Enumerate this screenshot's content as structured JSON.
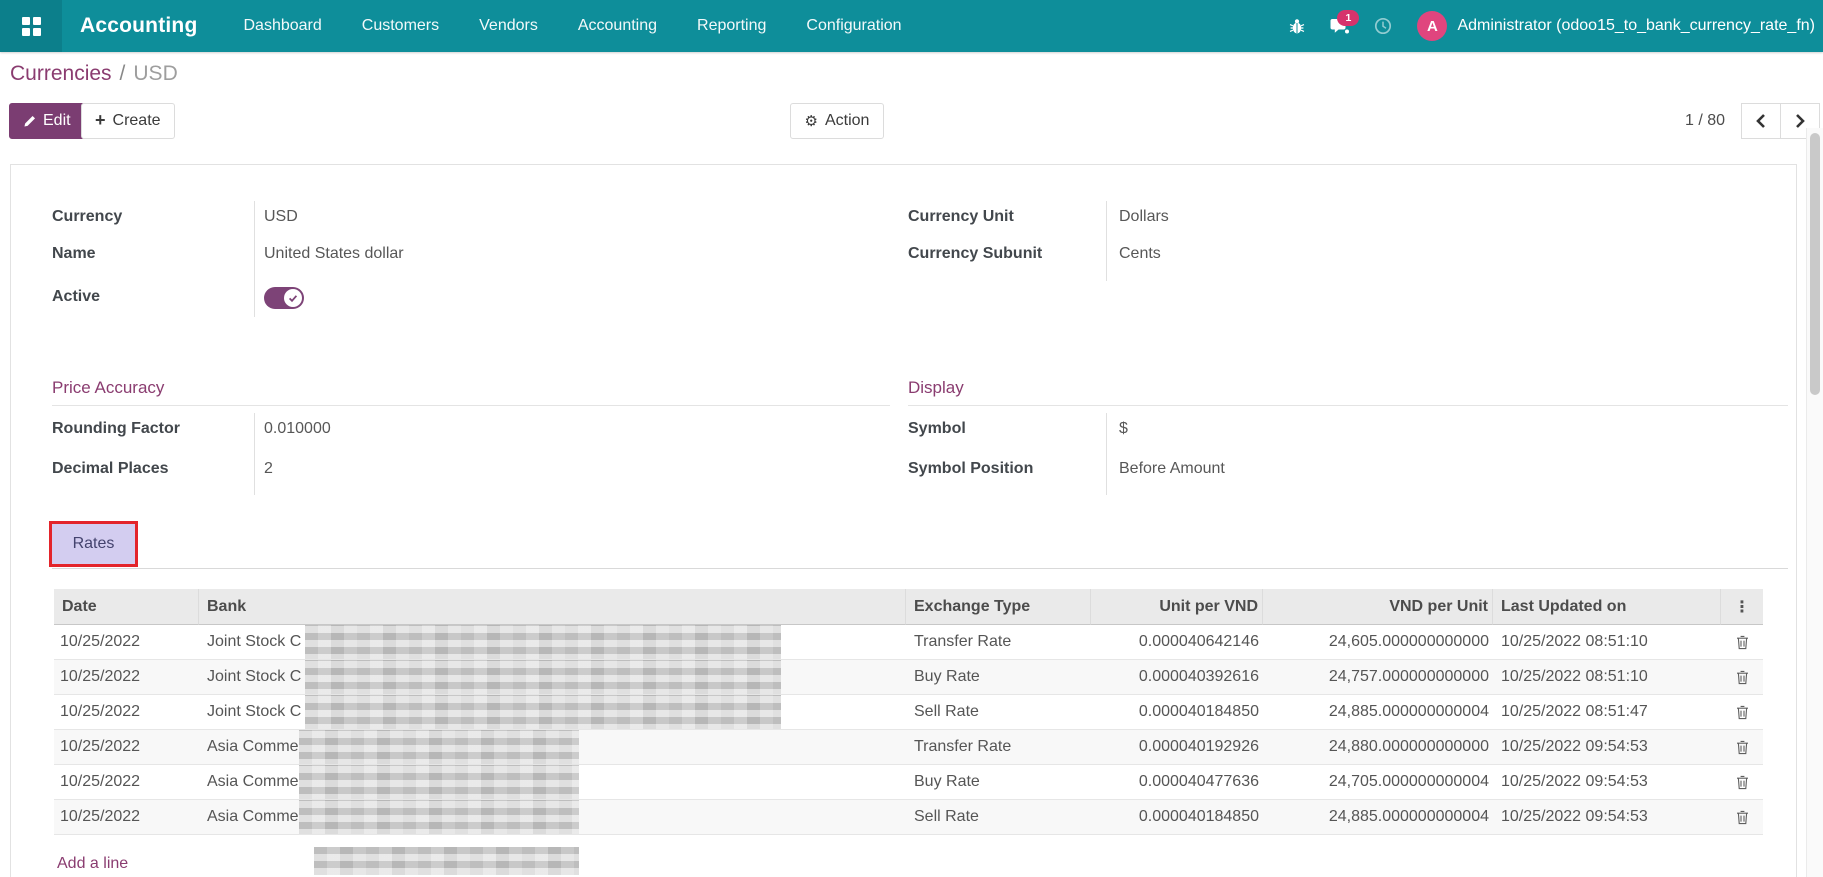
{
  "navbar": {
    "brand": "Accounting",
    "items": [
      {
        "label": "Dashboard"
      },
      {
        "label": "Customers"
      },
      {
        "label": "Vendors"
      },
      {
        "label": "Accounting"
      },
      {
        "label": "Reporting"
      },
      {
        "label": "Configuration"
      }
    ],
    "message_badge": "1",
    "user": {
      "initial": "A",
      "name": "Administrator (odoo15_to_bank_currency_rate_fn)"
    }
  },
  "breadcrumb": {
    "parent": "Currencies",
    "separator": "/",
    "current": "USD"
  },
  "control_panel": {
    "edit_label": "Edit",
    "create_label": "Create",
    "action_label": "Action",
    "pager": "1 / 80"
  },
  "form": {
    "currency_label": "Currency",
    "currency_value": "USD",
    "name_label": "Name",
    "name_value": "United States dollar",
    "active_label": "Active",
    "active": true,
    "currency_unit_label": "Currency Unit",
    "currency_unit_value": "Dollars",
    "currency_subunit_label": "Currency Subunit",
    "currency_subunit_value": "Cents",
    "price_accuracy": {
      "title": "Price Accuracy",
      "rounding_label": "Rounding Factor",
      "rounding_value": "0.010000",
      "decimal_label": "Decimal Places",
      "decimal_value": "2"
    },
    "display": {
      "title": "Display",
      "symbol_label": "Symbol",
      "symbol_value": "$",
      "position_label": "Symbol Position",
      "position_value": "Before Amount"
    },
    "tab_label": "Rates"
  },
  "table": {
    "headers": [
      "Date",
      "Bank",
      "Exchange Type",
      "Unit per VND",
      "VND per Unit",
      "Last Updated on"
    ],
    "rows": [
      {
        "date": "10/25/2022",
        "bank_prefix": "Joint Stock C",
        "exchange_type": "Transfer Rate",
        "unit_per_vnd": "0.000040642146",
        "vnd_per_unit": "24,605.000000000000",
        "last_updated": "10/25/2022 08:51:10"
      },
      {
        "date": "10/25/2022",
        "bank_prefix": "Joint Stock C",
        "exchange_type": "Buy Rate",
        "unit_per_vnd": "0.000040392616",
        "vnd_per_unit": "24,757.000000000000",
        "last_updated": "10/25/2022 08:51:10"
      },
      {
        "date": "10/25/2022",
        "bank_prefix": "Joint Stock C",
        "exchange_type": "Sell Rate",
        "unit_per_vnd": "0.000040184850",
        "vnd_per_unit": "24,885.000000000004",
        "last_updated": "10/25/2022 08:51:47"
      },
      {
        "date": "10/25/2022",
        "bank_prefix": "Asia Comme",
        "exchange_type": "Transfer Rate",
        "unit_per_vnd": "0.000040192926",
        "vnd_per_unit": "24,880.000000000000",
        "last_updated": "10/25/2022 09:54:53"
      },
      {
        "date": "10/25/2022",
        "bank_prefix": "Asia Comme",
        "exchange_type": "Buy Rate",
        "unit_per_vnd": "0.000040477636",
        "vnd_per_unit": "24,705.000000000004",
        "last_updated": "10/25/2022 09:54:53"
      },
      {
        "date": "10/25/2022",
        "bank_prefix": "Asia Comme",
        "exchange_type": "Sell Rate",
        "unit_per_vnd": "0.000040184850",
        "vnd_per_unit": "24,885.000000000004",
        "last_updated": "10/25/2022 09:54:53"
      }
    ],
    "add_line_label": "Add a line",
    "column_options_glyph": "⋮"
  },
  "icons": {
    "apps": "grid-icon",
    "debug": "bug-icon",
    "messages": "chat-bubble-icon",
    "activities": "clock-icon",
    "edit": "pencil-icon",
    "create": "plus-icon",
    "action": "gear-icon",
    "pager_prev": "chevron-left-icon",
    "pager_next": "chevron-right-icon",
    "delete": "trash-icon",
    "column_options": "vertical-ellipsis-icon",
    "active_on": "check-icon"
  },
  "colors": {
    "navbar": "#0e8e9a",
    "navbar_dark": "#0c7f8b",
    "primary_button": "#7b3d72",
    "link": "#8a3c70",
    "badge": "#d6336c",
    "avatar": "#e0457e",
    "toggle_on": "#7d4377",
    "tab_highlight_bg": "#d3cdf0",
    "annotation_border": "#e3242b"
  }
}
